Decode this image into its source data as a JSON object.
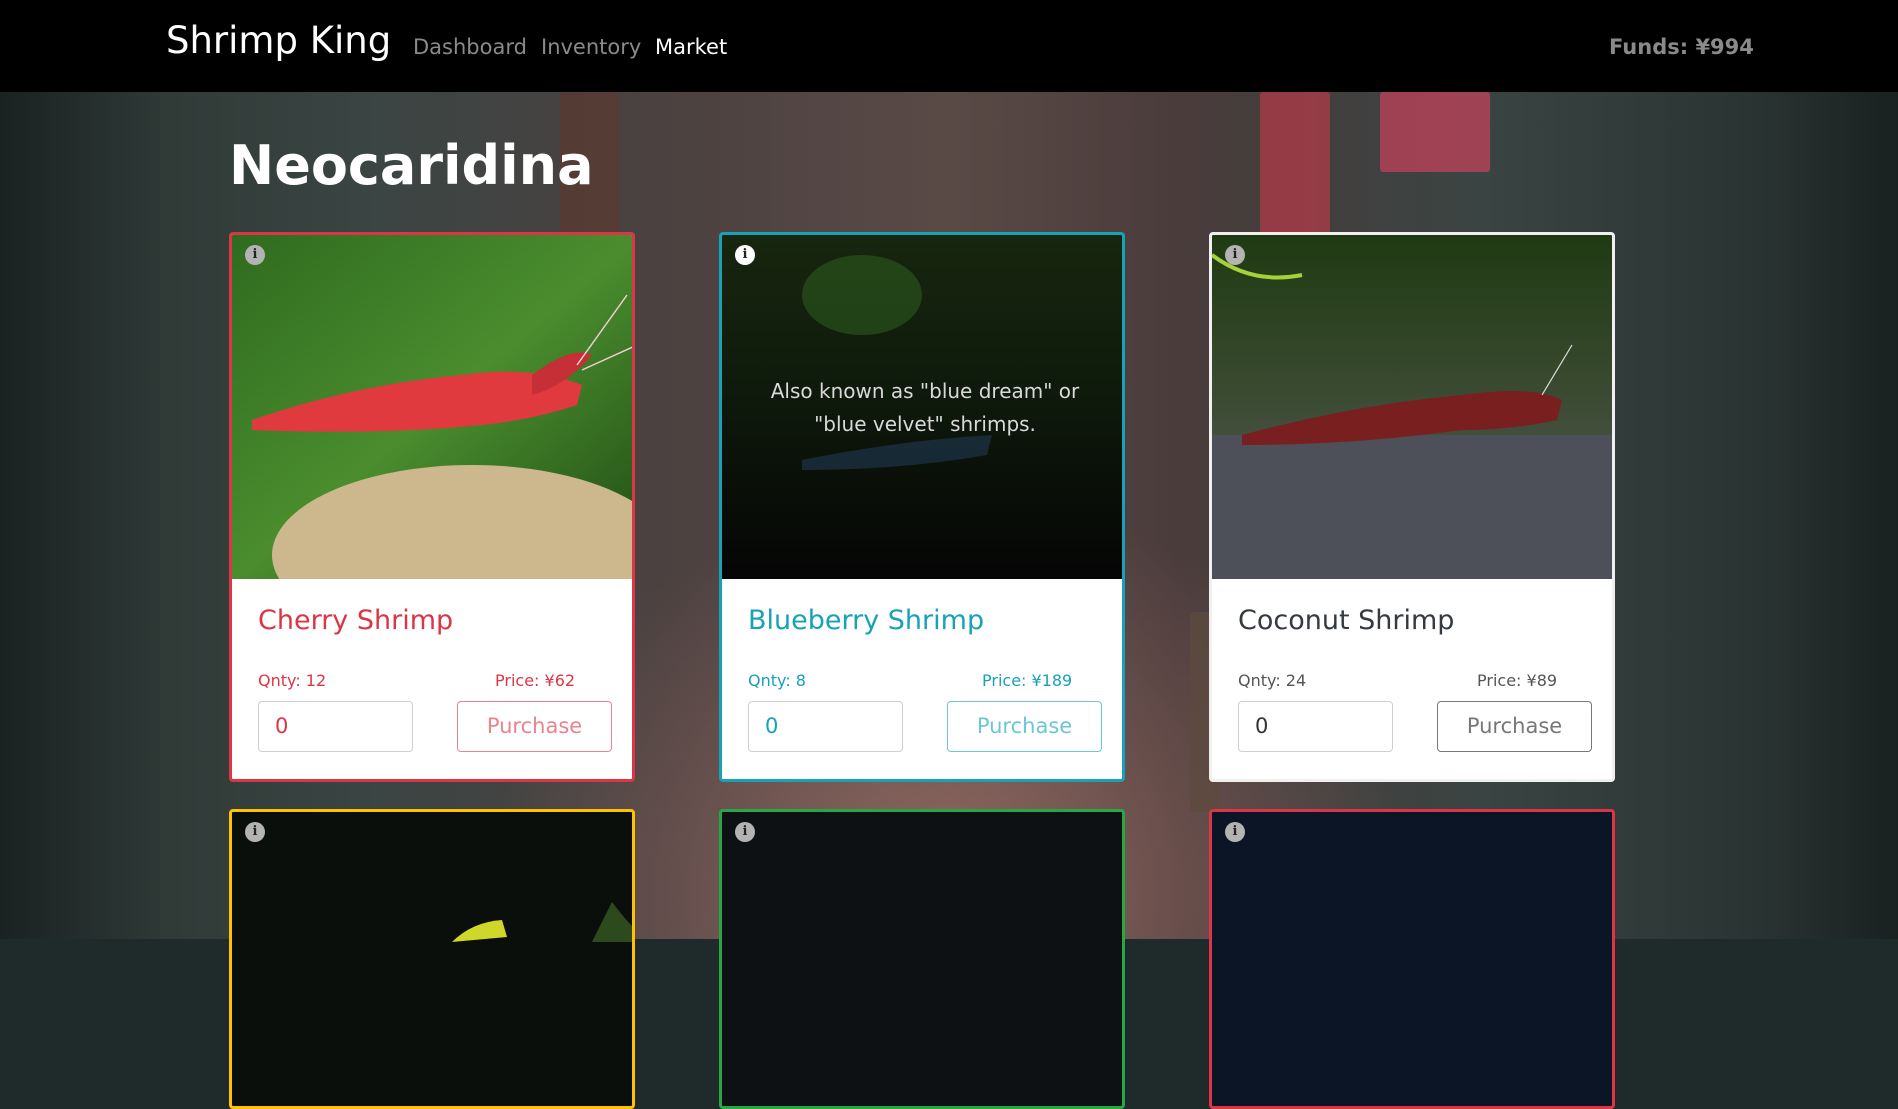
{
  "navbar": {
    "brand": "Shrimp King",
    "links": [
      {
        "label": "Dashboard",
        "active": false
      },
      {
        "label": "Inventory",
        "active": false
      },
      {
        "label": "Market",
        "active": true
      }
    ],
    "funds": "Funds: ¥994"
  },
  "page": {
    "title": "Neocaridina"
  },
  "cards": [
    {
      "name": "Cherry Shrimp",
      "qty": "Qnty: 12",
      "price": "Price: ¥62",
      "input_value": "0",
      "button_label": "Purchase",
      "accent": "#dc3545",
      "info_icon": "info-circle-icon",
      "description": ""
    },
    {
      "name": "Blueberry Shrimp",
      "qty": "Qnty: 8",
      "price": "Price: ¥189",
      "input_value": "0",
      "button_label": "Purchase",
      "accent": "#17a2b8",
      "info_icon": "info-circle-icon",
      "description": "Also known as \"blue dream\" or \"blue velvet\" shrimps."
    },
    {
      "name": "Coconut Shrimp",
      "qty": "Qnty: 24",
      "price": "Price: ¥89",
      "input_value": "0",
      "button_label": "Purchase",
      "accent": "#343a40",
      "info_icon": "info-circle-icon",
      "description": ""
    },
    {
      "accent": "#ffc107",
      "info_icon": "info-circle-icon"
    },
    {
      "accent": "#28a745",
      "info_icon": "info-circle-icon"
    },
    {
      "accent": "#dc3545",
      "info_icon": "info-circle-icon"
    }
  ]
}
